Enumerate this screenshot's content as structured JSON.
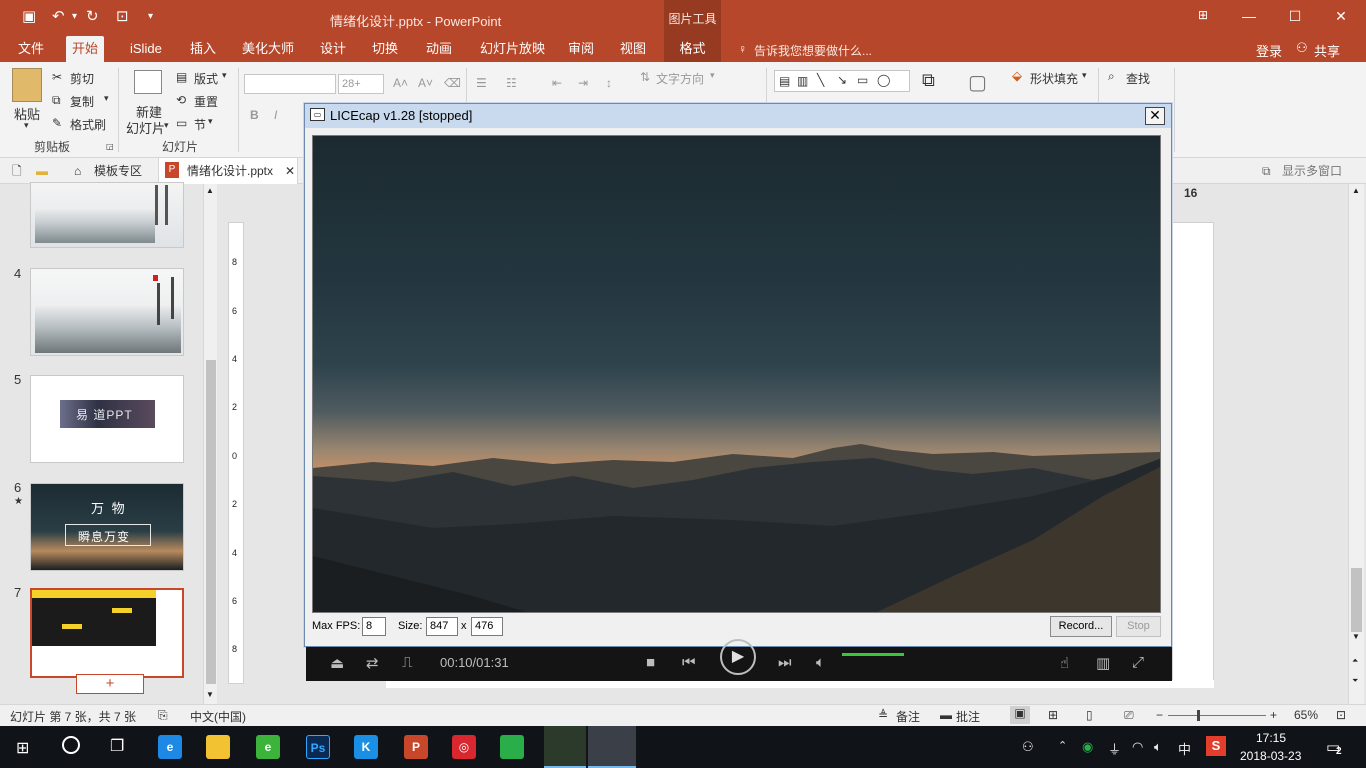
{
  "app": {
    "doc_title": "情绪化设计.pptx - PowerPoint",
    "context_tool": "图片工具",
    "user": {
      "login": "登录",
      "share": "共享"
    },
    "tell_me": "告诉我您想要做什么..."
  },
  "tabs": [
    {
      "label": "文件"
    },
    {
      "label": "开始",
      "active": true
    },
    {
      "label": "iSlide"
    },
    {
      "label": "插入"
    },
    {
      "label": "美化大师"
    },
    {
      "label": "设计"
    },
    {
      "label": "切换"
    },
    {
      "label": "动画"
    },
    {
      "label": "幻灯片放映"
    },
    {
      "label": "审阅"
    },
    {
      "label": "视图"
    },
    {
      "label": "格式"
    }
  ],
  "ribbon": {
    "clipboard": {
      "paste": "粘贴",
      "cut": "剪切",
      "copy": "复制",
      "format_painter": "格式刷",
      "group": "剪贴板"
    },
    "slides": {
      "new_slide": "新建",
      "new_slide2": "幻灯片",
      "layout": "版式",
      "reset": "重置",
      "section": "节",
      "group": "幻灯片"
    },
    "font": {
      "size": "28+",
      "bold": "B",
      "italic": "I"
    },
    "paragraph": {
      "text_direction": "文字方向"
    },
    "drawing": {
      "shape_fill": "形状填充"
    },
    "editing": {
      "find": "查找"
    }
  },
  "docbar": {
    "templates": "模板专区",
    "file_tab": "情绪化设计.pptx",
    "multi_window": "显示多窗口"
  },
  "thumbnails": [
    {
      "num": "4",
      "star": ""
    },
    {
      "num": "5",
      "text": "易 道PPT",
      "star": ""
    },
    {
      "num": "6",
      "text1": "万 物",
      "text2": "瞬息万变",
      "star": "★"
    },
    {
      "num": "7",
      "star": ""
    }
  ],
  "thumb_add": "+",
  "ruler": {
    "ticks": [
      "8",
      "6",
      "4",
      "2",
      "0",
      "2",
      "4",
      "6",
      "8"
    ]
  },
  "slide_page_badge": "16",
  "licecap": {
    "title": "LICEcap v1.28 [stopped]",
    "close": "✕",
    "max_fps_label": "Max FPS:",
    "max_fps": "8",
    "size_label": "Size:",
    "width": "847",
    "x": "x",
    "height": "476",
    "record": "Record...",
    "stop": "Stop"
  },
  "player": {
    "time": "00:10/01:31"
  },
  "statusbar": {
    "slide_info": "幻灯片 第 7 张，共 7 张",
    "language": "中文(中国)",
    "notes": "备注",
    "comments": "批注",
    "zoom": "65%"
  },
  "taskbar": {
    "time": "17:15",
    "date": "2018-03-23",
    "ime": "中",
    "notify_count": "2",
    "apps": [
      {
        "icon": "edge-icon",
        "color": "#1e88e5",
        "glyph": "e"
      },
      {
        "icon": "file-explorer-icon",
        "color": "#f2c233",
        "glyph": ""
      },
      {
        "icon": "browser-360-icon",
        "color": "#3cb43c",
        "glyph": "e"
      },
      {
        "icon": "photoshop-icon",
        "color": "#0a2a53",
        "glyph": "Ps"
      },
      {
        "icon": "kugou-icon",
        "color": "#1a8fe3",
        "glyph": "K"
      },
      {
        "icon": "powerpoint-icon",
        "color": "#c8462a",
        "glyph": "P"
      },
      {
        "icon": "netease-music-icon",
        "color": "#d8272f",
        "glyph": "◎"
      },
      {
        "icon": "wechat-icon",
        "color": "#2aae4a",
        "glyph": ""
      },
      {
        "icon": "green-app-icon",
        "color": "#2fbf3c",
        "glyph": ""
      },
      {
        "icon": "licecap-icon",
        "color": "#e8e8e8",
        "glyph": ""
      }
    ]
  }
}
